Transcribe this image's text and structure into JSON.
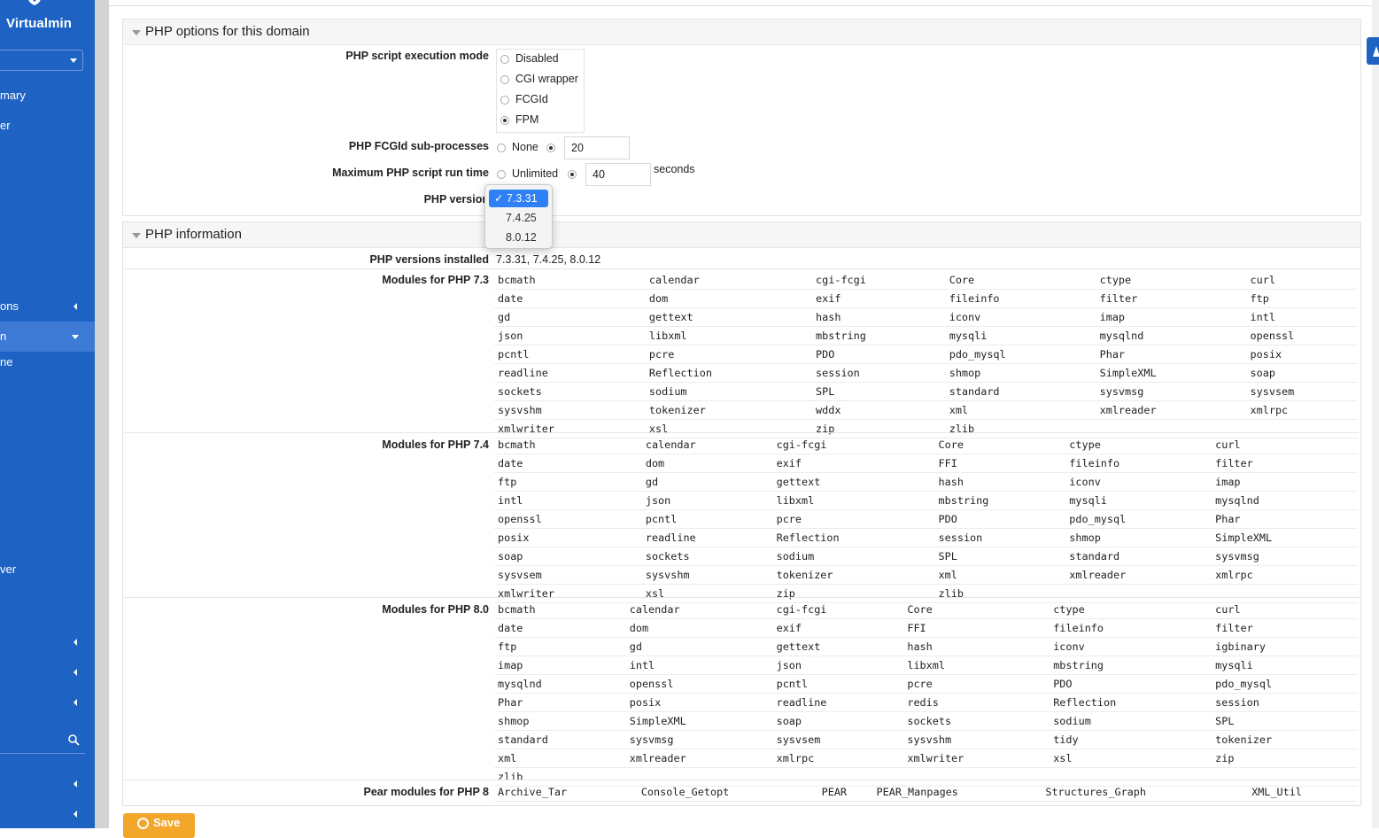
{
  "sidebar": {
    "brand": "Virtualmin",
    "items": [
      {
        "label": "mary"
      },
      {
        "label": "er"
      },
      {
        "label": "ons"
      },
      {
        "label": "n"
      },
      {
        "label": "ne"
      },
      {
        "label": "ver"
      }
    ]
  },
  "php_options": {
    "title": "PHP options for this domain",
    "exec_mode": {
      "label": "PHP script execution mode",
      "options": [
        "Disabled",
        "CGI wrapper",
        "FCGId",
        "FPM"
      ],
      "selected": "FPM"
    },
    "fcgid": {
      "label": "PHP FCGId sub-processes",
      "none_label": "None",
      "value": "20"
    },
    "max_run": {
      "label": "Maximum PHP script run time",
      "unlimited_label": "Unlimited",
      "value": "40",
      "unit": "seconds"
    },
    "version": {
      "label": "PHP version",
      "options": [
        "7.3.31",
        "7.4.25",
        "8.0.12"
      ],
      "selected": "7.3.31"
    }
  },
  "php_info": {
    "title": "PHP information",
    "installed_label": "PHP versions installed",
    "installed_value": "7.3.31, 7.4.25, 8.0.12",
    "modules_73_label": "Modules for PHP 7.3",
    "modules_73": [
      [
        "bcmath",
        "calendar",
        "cgi-fcgi",
        "Core",
        "ctype",
        "curl"
      ],
      [
        "date",
        "dom",
        "exif",
        "fileinfo",
        "filter",
        "ftp"
      ],
      [
        "gd",
        "gettext",
        "hash",
        "iconv",
        "imap",
        "intl"
      ],
      [
        "json",
        "libxml",
        "mbstring",
        "mysqli",
        "mysqlnd",
        "openssl"
      ],
      [
        "pcntl",
        "pcre",
        "PDO",
        "pdo_mysql",
        "Phar",
        "posix"
      ],
      [
        "readline",
        "Reflection",
        "session",
        "shmop",
        "SimpleXML",
        "soap"
      ],
      [
        "sockets",
        "sodium",
        "SPL",
        "standard",
        "sysvmsg",
        "sysvsem"
      ],
      [
        "sysvshm",
        "tokenizer",
        "wddx",
        "xml",
        "xmlreader",
        "xmlrpc"
      ],
      [
        "xmlwriter",
        "xsl",
        "zip",
        "zlib",
        "",
        ""
      ]
    ],
    "modules_74_label": "Modules for PHP 7.4",
    "modules_74": [
      [
        "bcmath",
        "calendar",
        "cgi-fcgi",
        "Core",
        "ctype",
        "curl"
      ],
      [
        "date",
        "dom",
        "exif",
        "FFI",
        "fileinfo",
        "filter"
      ],
      [
        "ftp",
        "gd",
        "gettext",
        "hash",
        "iconv",
        "imap"
      ],
      [
        "intl",
        "json",
        "libxml",
        "mbstring",
        "mysqli",
        "mysqlnd"
      ],
      [
        "openssl",
        "pcntl",
        "pcre",
        "PDO",
        "pdo_mysql",
        "Phar"
      ],
      [
        "posix",
        "readline",
        "Reflection",
        "session",
        "shmop",
        "SimpleXML"
      ],
      [
        "soap",
        "sockets",
        "sodium",
        "SPL",
        "standard",
        "sysvmsg"
      ],
      [
        "sysvsem",
        "sysvshm",
        "tokenizer",
        "xml",
        "xmlreader",
        "xmlrpc"
      ],
      [
        "xmlwriter",
        "xsl",
        "zip",
        "zlib",
        "",
        ""
      ]
    ],
    "modules_80_label": "Modules for PHP 8.0",
    "modules_80": [
      [
        "bcmath",
        "calendar",
        "cgi-fcgi",
        "Core",
        "ctype",
        "curl"
      ],
      [
        "date",
        "dom",
        "exif",
        "FFI",
        "fileinfo",
        "filter"
      ],
      [
        "ftp",
        "gd",
        "gettext",
        "hash",
        "iconv",
        "igbinary"
      ],
      [
        "imap",
        "intl",
        "json",
        "libxml",
        "mbstring",
        "mysqli"
      ],
      [
        "mysqlnd",
        "openssl",
        "pcntl",
        "pcre",
        "PDO",
        "pdo_mysql"
      ],
      [
        "Phar",
        "posix",
        "readline",
        "redis",
        "Reflection",
        "session"
      ],
      [
        "shmop",
        "SimpleXML",
        "soap",
        "sockets",
        "sodium",
        "SPL"
      ],
      [
        "standard",
        "sysvmsg",
        "sysvsem",
        "sysvshm",
        "tidy",
        "tokenizer"
      ],
      [
        "xml",
        "xmlreader",
        "xmlrpc",
        "xmlwriter",
        "xsl",
        "zip"
      ],
      [
        "zlib",
        "",
        "",
        "",
        "",
        ""
      ]
    ],
    "pear_label": "Pear modules for PHP 8",
    "pear": [
      [
        "Archive_Tar",
        "Console_Getopt",
        "PEAR",
        "PEAR_Manpages",
        "Structures_Graph",
        "XML_Util"
      ]
    ]
  },
  "save_button": "Save"
}
